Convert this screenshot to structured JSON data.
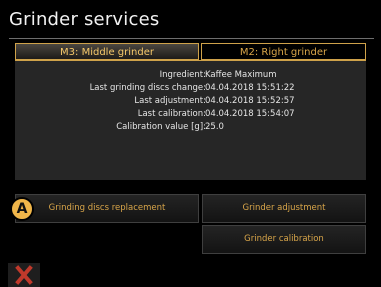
{
  "header": {
    "title": "Grinder services"
  },
  "tabs": [
    {
      "label": "M3: Middle grinder",
      "active": true
    },
    {
      "label": "M2: Right grinder",
      "active": false
    }
  ],
  "info": [
    {
      "label": "Ingredient:",
      "value": "Kaffee Maximum"
    },
    {
      "label": "Last grinding discs change:",
      "value": "04.04.2018 15:51:22"
    },
    {
      "label": "Last adjustment:",
      "value": "04.04.2018 15:52:57"
    },
    {
      "label": "Last calibration:",
      "value": "04.04.2018 15:54:07"
    },
    {
      "label": "Calibration value [g]:",
      "value": "25.0"
    }
  ],
  "buttons": {
    "discs_replacement": "Grinding discs replacement",
    "adjustment": "Grinder adjustment",
    "calibration": "Grinder calibration"
  },
  "marker": {
    "label": "A"
  },
  "icons": {
    "close": "close-icon"
  },
  "colors": {
    "accent": "#d9a64a",
    "background": "#000000",
    "panel": "#262626",
    "close": "#c0392b"
  }
}
